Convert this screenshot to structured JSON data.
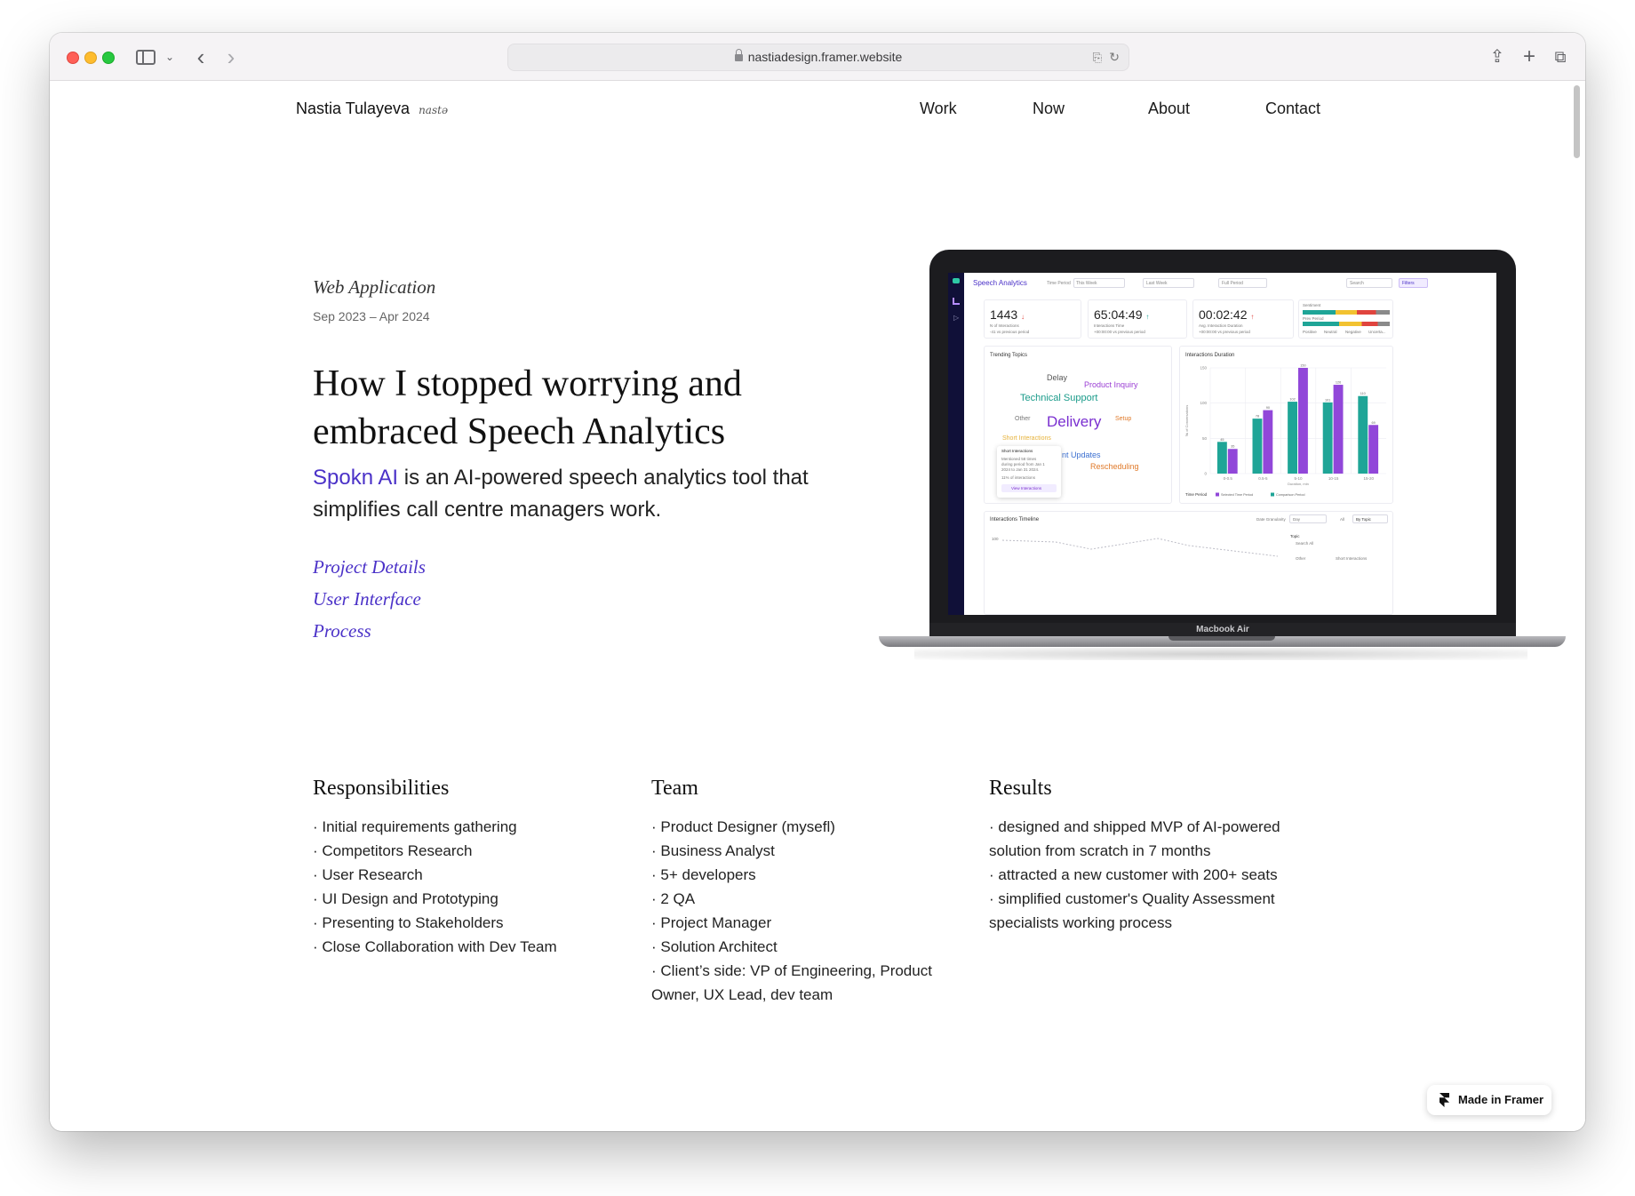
{
  "browser": {
    "url": "nastiadesign.framer.website"
  },
  "header": {
    "name": "Nastia Tulayeva",
    "nickname": "nastə",
    "nav": [
      "Work",
      "Now",
      "About",
      "Contact"
    ]
  },
  "hero": {
    "kicker": "Web Application",
    "dates": "Sep 2023 – Apr 2024",
    "headline": "How I stopped worrying and embraced Speech Analytics",
    "lead_brand": "Spokn AI",
    "lead_rest": " is an AI-powered speech analytics tool that simplifies call centre managers work.",
    "toc": [
      "Project Details",
      "User Interface",
      "Process"
    ]
  },
  "mockup": {
    "device_label": "Macbook Air",
    "app_title": "Speech Analytics",
    "filters": {
      "time_period_label": "Time Period",
      "time_period_value": "This Week",
      "compare_value": "Last Week",
      "period_value": "Full Period",
      "search_placeholder": "Search",
      "filters_button": "Filters"
    },
    "metrics": [
      {
        "value": "1443",
        "label": "N of Interactions",
        "delta": "-41 vs previous period",
        "arrow": "↓"
      },
      {
        "value": "65:04:49",
        "label": "Interactions Time",
        "delta": "+00:00:00 vs previous period",
        "arrow": "↑"
      },
      {
        "value": "00:02:42",
        "label": "Avg. Interaction Duration",
        "delta": "+00:00:00 vs previous period",
        "arrow": "↑"
      }
    ],
    "sentiment": {
      "title": "Sentiment",
      "prev_label": "Prev Period",
      "legend": [
        "Positive",
        "Neutral",
        "Negative",
        "Uncerta..."
      ]
    },
    "trending_title": "Trending Topics",
    "topics": [
      {
        "text": "Delay",
        "color": "#555555"
      },
      {
        "text": "Product Inquiry",
        "color": "#9b3fd4"
      },
      {
        "text": "Technical Support",
        "color": "#1a9b8a"
      },
      {
        "text": "Other",
        "color": "#777777"
      },
      {
        "text": "Delivery",
        "color": "#7a2fd0"
      },
      {
        "text": "Setup",
        "color": "#e07a2a"
      },
      {
        "text": "Short Interactions",
        "color": "#e6b23a"
      },
      {
        "text": "nt Updates",
        "color": "#3b6fd0"
      },
      {
        "text": "Rescheduling",
        "color": "#e07a2a"
      }
    ],
    "tooltip": {
      "title": "Short Interactions",
      "line1": "Mentioned 58 times",
      "line2": "during period from Jan 1",
      "line3": "2024 to Jan 31 2024.",
      "line4": "11% of interactions",
      "button": "View Interactions"
    },
    "timeline": {
      "title": "Interactions Timeline",
      "granularity_label": "Date Granularity",
      "granularity_value": "Day",
      "all_label": "All",
      "by_topic": "By Topic",
      "topic_label": "Topic",
      "search_all": "Search All",
      "opt1": "Other",
      "opt2": "Short Interactions",
      "y_tick": "100"
    },
    "legend": {
      "time_period": "Time Period",
      "selected": "Selected Time Period",
      "comparison": "Comparison Period"
    }
  },
  "chart_data": {
    "type": "bar",
    "title": "Interactions Duration",
    "xlabel": "Duration, min",
    "ylabel": "№ of Conversations",
    "categories": [
      "0-0.5",
      "0.5-5",
      "5-10",
      "10-15",
      "15-20"
    ],
    "ylim": [
      0,
      150
    ],
    "y_ticks": [
      0,
      50,
      100,
      150
    ],
    "series": [
      {
        "name": "Comparison Period",
        "color": "#1fa597",
        "values": [
          45,
          78,
          102,
          101,
          110
        ]
      },
      {
        "name": "Selected Time Period",
        "color": "#9147d9",
        "values": [
          35,
          90,
          150,
          126,
          69
        ]
      }
    ],
    "data_labels": [
      [
        "45",
        "35"
      ],
      [
        "78",
        "90"
      ],
      [
        "102",
        "150"
      ],
      [
        "101",
        "126"
      ],
      [
        "110",
        "69"
      ]
    ]
  },
  "sections": {
    "responsibilities": {
      "title": "Responsibilities",
      "items": [
        "· Initial requirements gathering",
        "· Competitors Research",
        "· User Research",
        "· UI Design and Prototyping",
        "· Presenting to Stakeholders",
        "· Close Collaboration with Dev Team"
      ]
    },
    "team": {
      "title": "Team",
      "items": [
        "· Product Designer (mysefl)",
        "· Business Analyst",
        "· 5+ developers",
        "· 2 QA",
        "· Project Manager",
        "· Solution Architect",
        "· Client’s side: VP of Engineering, Product Owner, UX Lead, dev team"
      ]
    },
    "results": {
      "title": "Results",
      "items": [
        "· designed and shipped MVP of AI-powered solution from scratch in 7 months",
        "· attracted a new customer with 200+ seats",
        "· simplified customer's Quality Assessment specialists working process"
      ]
    }
  },
  "badge": {
    "label": "Made in Framer"
  }
}
